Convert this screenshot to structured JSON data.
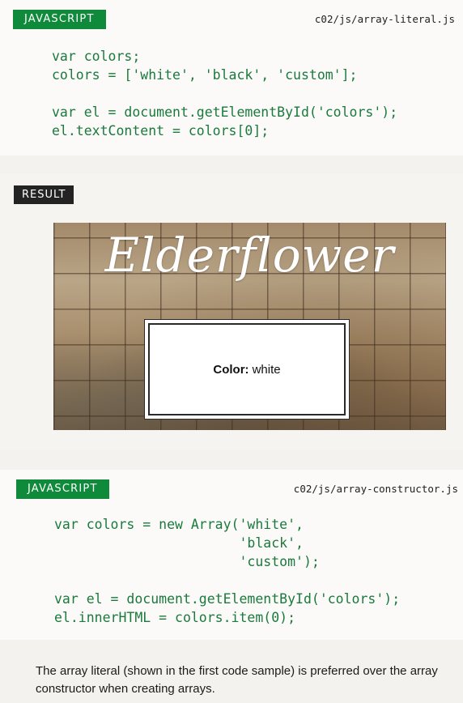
{
  "snippet1": {
    "label": "JAVASCRIPT",
    "path": "c02/js/array-literal.js",
    "code": "var colors;\ncolors = ['white', 'black', 'custom'];\n\nvar el = document.getElementById('colors');\nel.textContent = colors[0];"
  },
  "result": {
    "label": "RESULT",
    "brand": "Elderflower",
    "color_label": "Color:",
    "color_value": "white"
  },
  "snippet2": {
    "label": "JAVASCRIPT",
    "path": "c02/js/array-constructor.js",
    "code": "var colors = new Array('white',\n                       'black',\n                       'custom');\n\nvar el = document.getElementById('colors');\nel.innerHTML = colors.item(0);"
  },
  "caption": "The array literal (shown in the first code sample) is preferred over the array constructor when creating arrays."
}
